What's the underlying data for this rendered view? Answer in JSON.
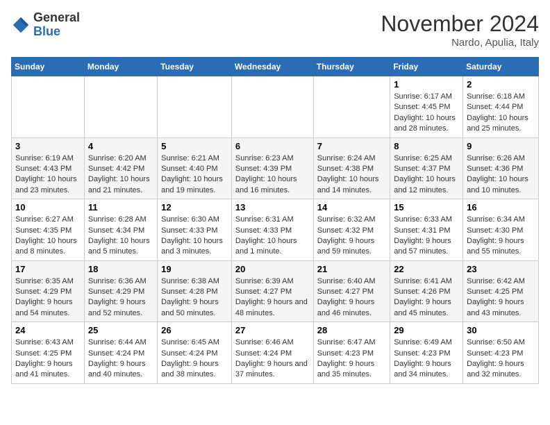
{
  "header": {
    "logo_general": "General",
    "logo_blue": "Blue",
    "month_title": "November 2024",
    "location": "Nardo, Apulia, Italy"
  },
  "days_of_week": [
    "Sunday",
    "Monday",
    "Tuesday",
    "Wednesday",
    "Thursday",
    "Friday",
    "Saturday"
  ],
  "weeks": [
    [
      {
        "day": "",
        "info": ""
      },
      {
        "day": "",
        "info": ""
      },
      {
        "day": "",
        "info": ""
      },
      {
        "day": "",
        "info": ""
      },
      {
        "day": "",
        "info": ""
      },
      {
        "day": "1",
        "info": "Sunrise: 6:17 AM\nSunset: 4:45 PM\nDaylight: 10 hours and 28 minutes."
      },
      {
        "day": "2",
        "info": "Sunrise: 6:18 AM\nSunset: 4:44 PM\nDaylight: 10 hours and 25 minutes."
      }
    ],
    [
      {
        "day": "3",
        "info": "Sunrise: 6:19 AM\nSunset: 4:43 PM\nDaylight: 10 hours and 23 minutes."
      },
      {
        "day": "4",
        "info": "Sunrise: 6:20 AM\nSunset: 4:42 PM\nDaylight: 10 hours and 21 minutes."
      },
      {
        "day": "5",
        "info": "Sunrise: 6:21 AM\nSunset: 4:40 PM\nDaylight: 10 hours and 19 minutes."
      },
      {
        "day": "6",
        "info": "Sunrise: 6:23 AM\nSunset: 4:39 PM\nDaylight: 10 hours and 16 minutes."
      },
      {
        "day": "7",
        "info": "Sunrise: 6:24 AM\nSunset: 4:38 PM\nDaylight: 10 hours and 14 minutes."
      },
      {
        "day": "8",
        "info": "Sunrise: 6:25 AM\nSunset: 4:37 PM\nDaylight: 10 hours and 12 minutes."
      },
      {
        "day": "9",
        "info": "Sunrise: 6:26 AM\nSunset: 4:36 PM\nDaylight: 10 hours and 10 minutes."
      }
    ],
    [
      {
        "day": "10",
        "info": "Sunrise: 6:27 AM\nSunset: 4:35 PM\nDaylight: 10 hours and 8 minutes."
      },
      {
        "day": "11",
        "info": "Sunrise: 6:28 AM\nSunset: 4:34 PM\nDaylight: 10 hours and 5 minutes."
      },
      {
        "day": "12",
        "info": "Sunrise: 6:30 AM\nSunset: 4:33 PM\nDaylight: 10 hours and 3 minutes."
      },
      {
        "day": "13",
        "info": "Sunrise: 6:31 AM\nSunset: 4:33 PM\nDaylight: 10 hours and 1 minute."
      },
      {
        "day": "14",
        "info": "Sunrise: 6:32 AM\nSunset: 4:32 PM\nDaylight: 9 hours and 59 minutes."
      },
      {
        "day": "15",
        "info": "Sunrise: 6:33 AM\nSunset: 4:31 PM\nDaylight: 9 hours and 57 minutes."
      },
      {
        "day": "16",
        "info": "Sunrise: 6:34 AM\nSunset: 4:30 PM\nDaylight: 9 hours and 55 minutes."
      }
    ],
    [
      {
        "day": "17",
        "info": "Sunrise: 6:35 AM\nSunset: 4:29 PM\nDaylight: 9 hours and 54 minutes."
      },
      {
        "day": "18",
        "info": "Sunrise: 6:36 AM\nSunset: 4:29 PM\nDaylight: 9 hours and 52 minutes."
      },
      {
        "day": "19",
        "info": "Sunrise: 6:38 AM\nSunset: 4:28 PM\nDaylight: 9 hours and 50 minutes."
      },
      {
        "day": "20",
        "info": "Sunrise: 6:39 AM\nSunset: 4:27 PM\nDaylight: 9 hours and 48 minutes."
      },
      {
        "day": "21",
        "info": "Sunrise: 6:40 AM\nSunset: 4:27 PM\nDaylight: 9 hours and 46 minutes."
      },
      {
        "day": "22",
        "info": "Sunrise: 6:41 AM\nSunset: 4:26 PM\nDaylight: 9 hours and 45 minutes."
      },
      {
        "day": "23",
        "info": "Sunrise: 6:42 AM\nSunset: 4:25 PM\nDaylight: 9 hours and 43 minutes."
      }
    ],
    [
      {
        "day": "24",
        "info": "Sunrise: 6:43 AM\nSunset: 4:25 PM\nDaylight: 9 hours and 41 minutes."
      },
      {
        "day": "25",
        "info": "Sunrise: 6:44 AM\nSunset: 4:24 PM\nDaylight: 9 hours and 40 minutes."
      },
      {
        "day": "26",
        "info": "Sunrise: 6:45 AM\nSunset: 4:24 PM\nDaylight: 9 hours and 38 minutes."
      },
      {
        "day": "27",
        "info": "Sunrise: 6:46 AM\nSunset: 4:24 PM\nDaylight: 9 hours and 37 minutes."
      },
      {
        "day": "28",
        "info": "Sunrise: 6:47 AM\nSunset: 4:23 PM\nDaylight: 9 hours and 35 minutes."
      },
      {
        "day": "29",
        "info": "Sunrise: 6:49 AM\nSunset: 4:23 PM\nDaylight: 9 hours and 34 minutes."
      },
      {
        "day": "30",
        "info": "Sunrise: 6:50 AM\nSunset: 4:23 PM\nDaylight: 9 hours and 32 minutes."
      }
    ]
  ]
}
